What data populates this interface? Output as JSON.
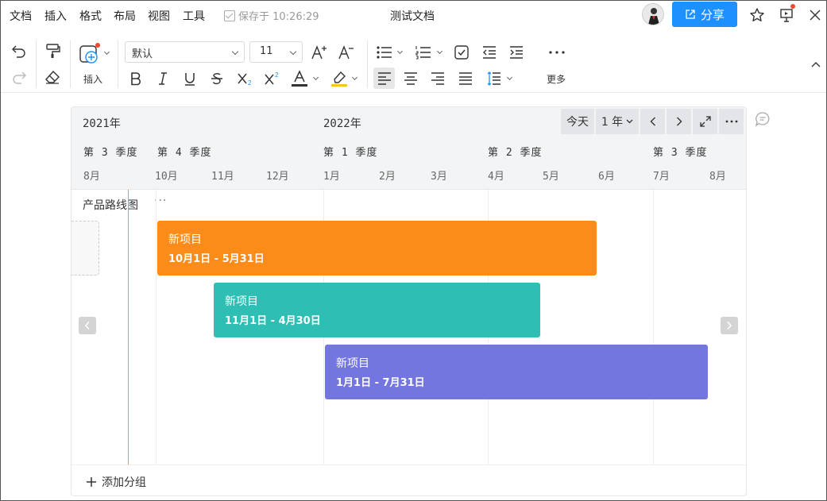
{
  "menu": {
    "items": [
      "文档",
      "插入",
      "格式",
      "布局",
      "视图",
      "工具"
    ],
    "save_status": "保存于 10:26:29",
    "doc_title": "测试文档",
    "share_label": "分享"
  },
  "toolbar": {
    "insert_label": "插入",
    "font_family": "默认",
    "font_size": "11",
    "more_label": "更多"
  },
  "timeline": {
    "years": [
      "2021年",
      "2022年"
    ],
    "quarters": [
      "第 3 季度",
      "第 4 季度",
      "第 1 季度",
      "第 2 季度",
      "第 3 季度"
    ],
    "months": [
      "8月",
      "10月",
      "11月",
      "12月",
      "1月",
      "2月",
      "3月",
      "4月",
      "5月",
      "6月",
      "7月",
      "8月"
    ],
    "today_label": "今天",
    "zoom_label": "1 年",
    "group_title": "产品路线图",
    "group_more": "···",
    "add_group_label": "添加分组",
    "bars": [
      {
        "title": "新项目",
        "dates": "10月1日 - 5月31日",
        "color": "#fb8c19"
      },
      {
        "title": "新项目",
        "dates": "11月1日 - 4月30日",
        "color": "#2fbeb4"
      },
      {
        "title": "新项目",
        "dates": "1月1日 - 7月31日",
        "color": "#7476df"
      }
    ]
  },
  "colors": {
    "accent": "#1e90ff",
    "today_line": "#e39a4c",
    "notification_dot": "#f04a2e"
  }
}
